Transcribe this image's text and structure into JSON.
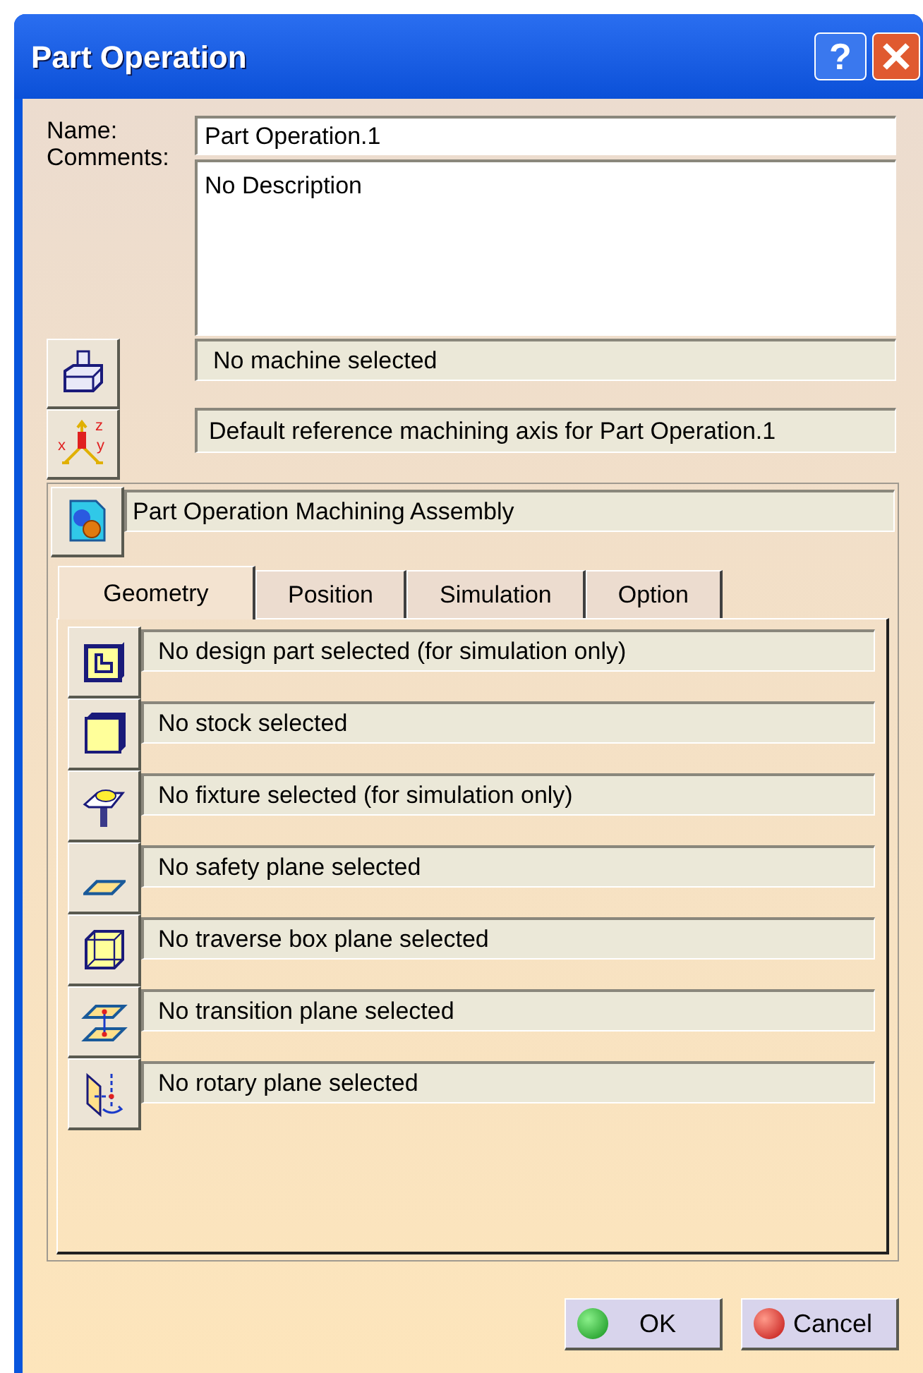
{
  "window": {
    "title": "Part Operation",
    "help": "?"
  },
  "name": {
    "label": "Name:",
    "value": "Part Operation.1"
  },
  "comments": {
    "label": "Comments:",
    "value": "No Description"
  },
  "machine": {
    "value": "No machine selected"
  },
  "axis": {
    "value": "Default reference machining axis for Part Operation.1",
    "icon_letters": [
      "z",
      "x",
      "y"
    ]
  },
  "assembly": {
    "value": "Part Operation Machining Assembly"
  },
  "tabs": [
    {
      "label": "Geometry",
      "selected": true
    },
    {
      "label": "Position",
      "selected": false
    },
    {
      "label": "Simulation",
      "selected": false
    },
    {
      "label": "Option",
      "selected": false
    }
  ],
  "geometry_rows": [
    {
      "kind": "design",
      "value": "No design part selected (for simulation only)"
    },
    {
      "kind": "stock",
      "value": "No stock selected"
    },
    {
      "kind": "fixture",
      "value": "No fixture selected (for simulation only)"
    },
    {
      "kind": "safety",
      "value": "No safety plane selected"
    },
    {
      "kind": "traverse",
      "value": "No traverse box plane selected"
    },
    {
      "kind": "transition",
      "value": "No transition plane selected"
    },
    {
      "kind": "rotary",
      "value": "No rotary plane selected"
    }
  ],
  "buttons": [
    {
      "kind": "ok",
      "label": "OK"
    },
    {
      "kind": "cancel",
      "label": "Cancel"
    }
  ]
}
